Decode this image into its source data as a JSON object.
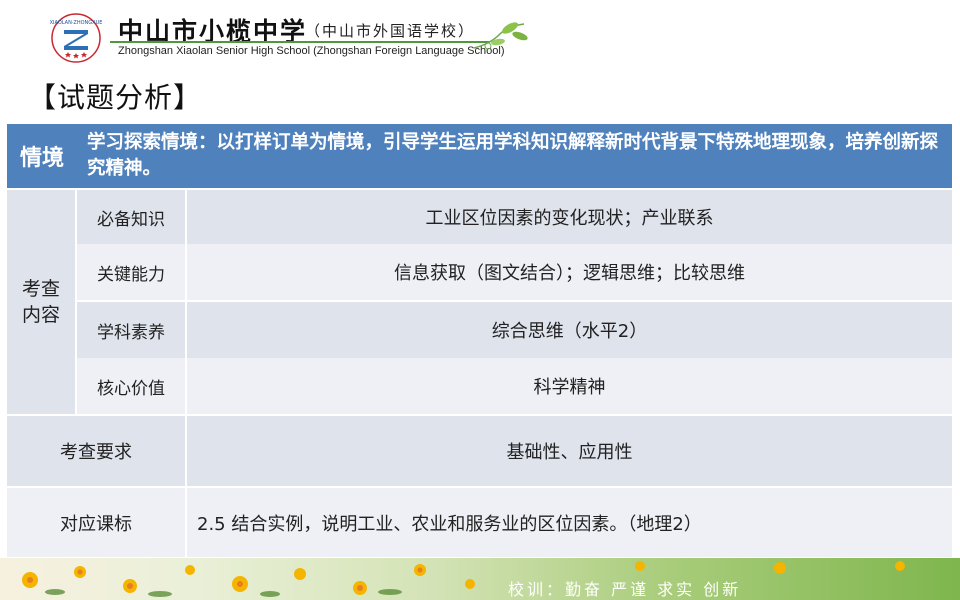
{
  "header": {
    "logo_letters": "ZZ",
    "logo_ring_text": "XIAOLANZHONGXUE",
    "school_name_cn": "中山市小榄中学",
    "school_name_cn_sub": "（中山市外国语学校）",
    "school_name_en": "Zhongshan Xiaolan Senior High School  (Zhongshan Foreign Language School)"
  },
  "section_title": "【试题分析】",
  "table": {
    "context": {
      "label": "情境",
      "text": "学习探索情境：以打样订单为情境，引导学生运用学科知识解释新时代背景下特殊地理现象，培养创新探究精神。"
    },
    "content_group_label": "考查内容",
    "content_rows": [
      {
        "label": "必备知识",
        "value": "工业区位因素的变化现状；产业联系"
      },
      {
        "label": "关键能力",
        "value": "信息获取（图文结合）；逻辑思维；比较思维"
      },
      {
        "label": "学科素养",
        "value": "综合思维（水平2）"
      },
      {
        "label": "核心价值",
        "value": "科学精神"
      }
    ],
    "requirement": {
      "label": "考查要求",
      "value": "基础性、应用性"
    },
    "standard": {
      "label": "对应课标",
      "value": "2.5 结合实例，说明工业、农业和服务业的区位因素。（地理2）"
    }
  },
  "footer": {
    "motto": "校训：勤奋  严谨  求实  创新"
  },
  "colors": {
    "header_blue": "#4f81bd",
    "row_light": "#dfe3ec",
    "row_lighter": "#eef0f5",
    "accent_green": "#4d9a3a"
  }
}
